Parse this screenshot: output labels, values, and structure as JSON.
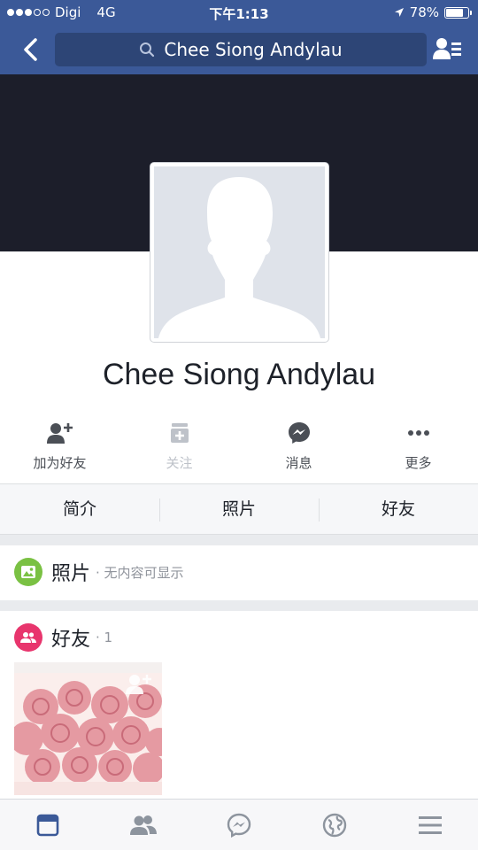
{
  "status_bar": {
    "carrier": "Digi",
    "network": "4G",
    "time": "下午1:13",
    "battery": "78%",
    "battery_level": 0.78
  },
  "nav": {
    "search_text": "Chee Siong Andylau",
    "back_icon": "chevron-left-icon",
    "friend_requests_icon": "friend-requests-icon"
  },
  "profile": {
    "name": "Chee Siong Andylau"
  },
  "actions": [
    {
      "label": "加为好友",
      "icon": "add-friend-icon",
      "enabled": true
    },
    {
      "label": "关注",
      "icon": "follow-icon",
      "enabled": false
    },
    {
      "label": "消息",
      "icon": "messenger-icon",
      "enabled": true
    },
    {
      "label": "更多",
      "icon": "more-icon",
      "enabled": true
    }
  ],
  "tabs": [
    {
      "label": "简介"
    },
    {
      "label": "照片"
    },
    {
      "label": "好友"
    }
  ],
  "photos_section": {
    "title": "照片",
    "subtitle": "· 无内容可显示"
  },
  "friends_section": {
    "title": "好友",
    "count": "· 1"
  },
  "bottom_tabs": [
    {
      "icon": "news-feed-icon",
      "active": true
    },
    {
      "icon": "friends-icon",
      "active": false
    },
    {
      "icon": "messenger-icon",
      "active": false
    },
    {
      "icon": "notifications-globe-icon",
      "active": false
    },
    {
      "icon": "menu-icon",
      "active": false
    }
  ],
  "colors": {
    "brand_blue": "#3b5998",
    "search_box": "#2d4576",
    "photos_icon_bg": "#7ac143",
    "friends_icon_bg": "#e8356d",
    "active_tab": "#3b5998",
    "inactive_tab": "#8d949e"
  }
}
